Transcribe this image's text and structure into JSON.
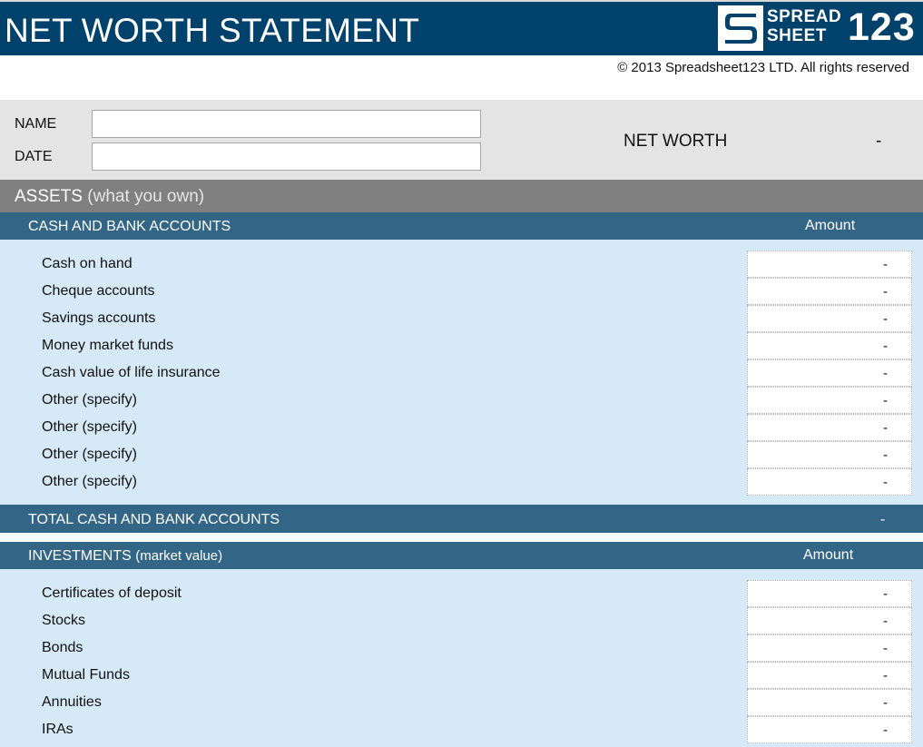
{
  "header": {
    "title": "NET WORTH STATEMENT",
    "logo": {
      "line1": "SPREAD",
      "line2": "SHEET",
      "number": "123",
      "icon": "s-logo-icon"
    }
  },
  "copyright": "© 2013 Spreadsheet123 LTD. All rights reserved",
  "info": {
    "name_label": "NAME",
    "name_value": "",
    "date_label": "DATE",
    "date_value": "",
    "net_worth_label": "NET WORTH",
    "net_worth_value": "-"
  },
  "assets": {
    "title": "ASSETS",
    "subtitle": "(what you own)"
  },
  "cash": {
    "title": "CASH AND BANK ACCOUNTS",
    "amount_header": "Amount",
    "rows": [
      {
        "label": "Cash on hand",
        "value": "-"
      },
      {
        "label": "Cheque accounts",
        "value": "-"
      },
      {
        "label": "Savings accounts",
        "value": "-"
      },
      {
        "label": "Money market funds",
        "value": "-"
      },
      {
        "label": "Cash value of life insurance",
        "value": "-"
      },
      {
        "label": "Other (specify)",
        "value": "-"
      },
      {
        "label": "Other (specify)",
        "value": "-"
      },
      {
        "label": "Other (specify)",
        "value": "-"
      },
      {
        "label": "Other (specify)",
        "value": "-"
      }
    ],
    "total_label": "TOTAL CASH AND BANK ACCOUNTS",
    "total_value": "-"
  },
  "investments": {
    "title": "INVESTMENTS",
    "subtitle": "(market value)",
    "amount_header": "Amount",
    "rows": [
      {
        "label": "Certificates of deposit",
        "value": "-"
      },
      {
        "label": "Stocks",
        "value": "-"
      },
      {
        "label": "Bonds",
        "value": "-"
      },
      {
        "label": "Mutual Funds",
        "value": "-"
      },
      {
        "label": "Annuities",
        "value": "-"
      },
      {
        "label": "IRAs",
        "value": "-"
      }
    ]
  },
  "colors": {
    "header_bg": "#00426b",
    "section_bg": "#336587",
    "assets_bg": "#808080",
    "row_bg": "#d6e9f6",
    "info_bg": "#e4e4e4"
  }
}
